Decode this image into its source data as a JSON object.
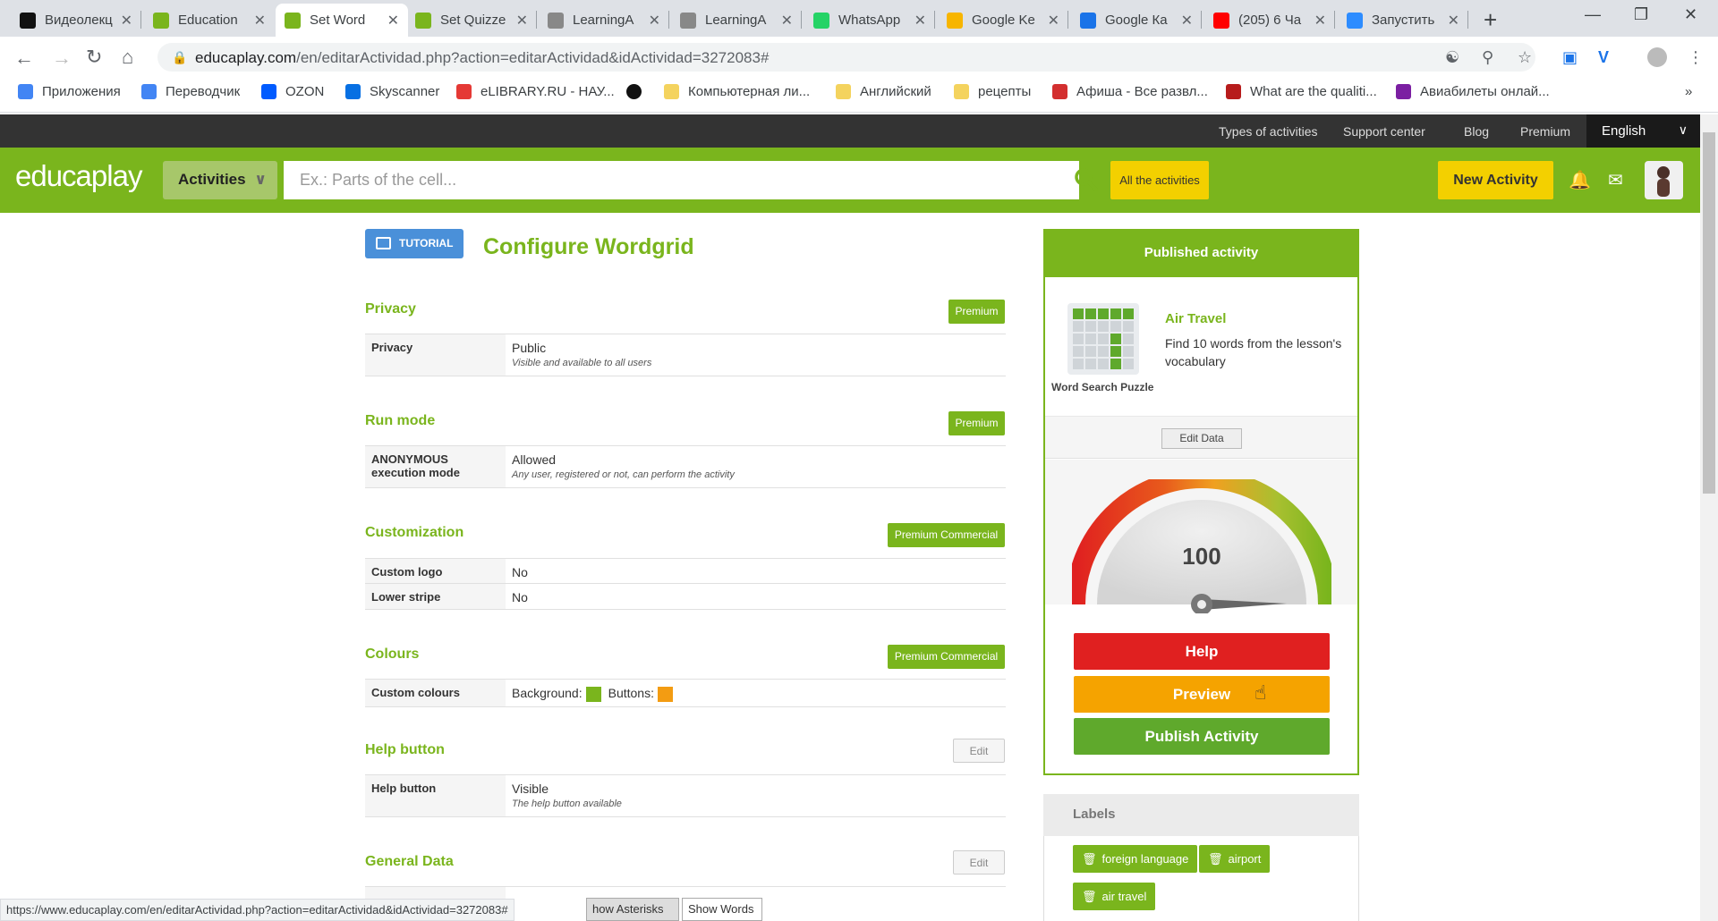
{
  "browser": {
    "tabs": [
      {
        "title": "Видеолекц",
        "icon": "brand-icon",
        "color": "#111111"
      },
      {
        "title": "Education",
        "icon": "educaplay-icon",
        "color": "#7ab51d"
      },
      {
        "title": "Set Word",
        "icon": "educaplay-icon",
        "color": "#7ab51d"
      },
      {
        "title": "Set Quizze",
        "icon": "educaplay-icon",
        "color": "#7ab51d"
      },
      {
        "title": "LearningA",
        "icon": "learningapps-icon",
        "color": "#888888"
      },
      {
        "title": "LearningA",
        "icon": "learningapps-icon",
        "color": "#888888"
      },
      {
        "title": "WhatsApp",
        "icon": "whatsapp-icon",
        "color": "#25d366"
      },
      {
        "title": "Google Ke",
        "icon": "google-keep-icon",
        "color": "#f7b500"
      },
      {
        "title": "Google Ка",
        "icon": "google-calendar-icon",
        "color": "#1a73e8"
      },
      {
        "title": "(205) 6 Ча",
        "icon": "youtube-icon",
        "color": "#ff0000"
      },
      {
        "title": "Запустить",
        "icon": "zoom-icon",
        "color": "#2d8cff"
      }
    ],
    "url_host": "educaplay.com",
    "url_path": "/en/editarActividad.php?action=editarActividad&idActividad=3272083#",
    "bookmarks": [
      {
        "label": "Приложения",
        "color": "#4285f4"
      },
      {
        "label": "Переводчик",
        "color": "#4285f4"
      },
      {
        "label": "OZON",
        "color": "#005bff"
      },
      {
        "label": "Skyscanner",
        "color": "#0770e3"
      },
      {
        "label": "eLIBRARY.RU - НАУ...",
        "color": "#e53935"
      },
      {
        "label": "",
        "color": "#111111"
      },
      {
        "label": "Компьютерная ли...",
        "color": "#f4d35e"
      },
      {
        "label": "Английский",
        "color": "#f4d35e"
      },
      {
        "label": "рецепты",
        "color": "#f4d35e"
      },
      {
        "label": "Афиша - Все развл...",
        "color": "#d32f2f"
      },
      {
        "label": "What are the qualiti...",
        "color": "#b71c1c"
      },
      {
        "label": "Авиабилеты онлай...",
        "color": "#7b1fa2"
      }
    ],
    "status_url": "https://www.educaplay.com/en/editarActividad.php?action=editarActividad&idActividad=3272083#"
  },
  "site": {
    "top_links": [
      "Types of activities",
      "Support center",
      "Blog",
      "Premium"
    ],
    "language": "English",
    "logo": "educaplay",
    "activities_label": "Activities",
    "search_placeholder": "Ex.: Parts of the cell...",
    "all_activities": "All the activities",
    "new_activity": "New Activity"
  },
  "page": {
    "tutorial": "TUTORIAL",
    "title": "Configure Wordgrid",
    "sections": {
      "privacy": {
        "title": "Privacy",
        "button": "Premium",
        "label": "Privacy",
        "value": "Public",
        "sub": "Visible and available to all users"
      },
      "run_mode": {
        "title": "Run mode",
        "button": "Premium",
        "label": "ANONYMOUS execution mode",
        "value": "Allowed",
        "sub": "Any user, registered or not, can perform the activity"
      },
      "customization": {
        "title": "Customization",
        "button": "Premium Commercial",
        "rows": [
          {
            "label": "Custom logo",
            "value": "No"
          },
          {
            "label": "Lower stripe",
            "value": "No"
          }
        ]
      },
      "colours": {
        "title": "Colours",
        "button": "Premium Commercial",
        "label": "Custom colours",
        "background_label": "Background:",
        "buttons_label": "Buttons:",
        "background_color": "#7ab51d",
        "buttons_color": "#f39c12"
      },
      "help_button": {
        "title": "Help button",
        "button": "Edit",
        "label": "Help button",
        "value": "Visible",
        "sub": "The help button available"
      },
      "general_data": {
        "title": "General Data",
        "button": "Edit"
      }
    },
    "bottom_buttons": [
      "how Asterisks",
      "Show Words"
    ]
  },
  "panel": {
    "header": "Published activity",
    "activity_type": "Word Search Puzzle",
    "activity_name": "Air Travel",
    "activity_desc": "Find 10 words from the lesson's vocabulary",
    "edit_data": "Edit Data",
    "gauge_value": 100,
    "gauge_max": 100,
    "help": "Help",
    "preview": "Preview",
    "publish": "Publish Activity",
    "colors": {
      "help": "#e02020",
      "preview": "#f5a300",
      "publish": "#5fa92c"
    }
  },
  "labels": {
    "title": "Labels",
    "tags": [
      "foreign language",
      "airport",
      "air travel"
    ]
  }
}
